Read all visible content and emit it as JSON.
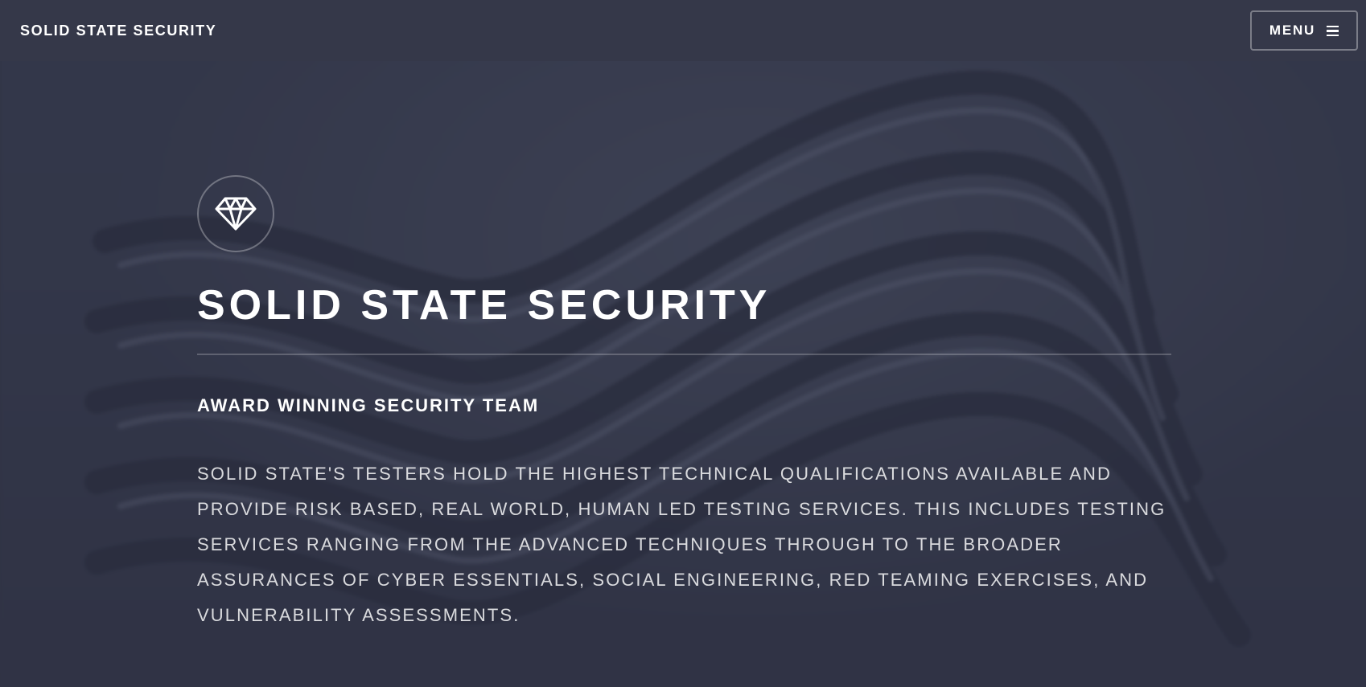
{
  "header": {
    "brand": "SOLID STATE SECURITY",
    "menu_label": "MENU",
    "menu_icon": "hamburger-icon"
  },
  "hero": {
    "logo_icon": "diamond-icon",
    "title": "SOLID STATE SECURITY",
    "subtitle": "AWARD WINNING SECURITY TEAM",
    "description": "SOLID STATE'S TESTERS HOLD THE HIGHEST TECHNICAL QUALIFICATIONS AVAILABLE AND PROVIDE RISK BASED, REAL WORLD, HUMAN LED TESTING SERVICES. THIS INCLUDES TESTING SERVICES RANGING FROM THE ADVANCED TECHNIQUES THROUGH TO THE BROADER ASSURANCES OF CYBER ESSENTIALS, SOCIAL ENGINEERING, RED TEAMING EXERCISES, AND VULNERABILITY ASSESSMENTS."
  },
  "colors": {
    "background": "#2e3141",
    "header": "#353849",
    "text": "#ffffff"
  }
}
